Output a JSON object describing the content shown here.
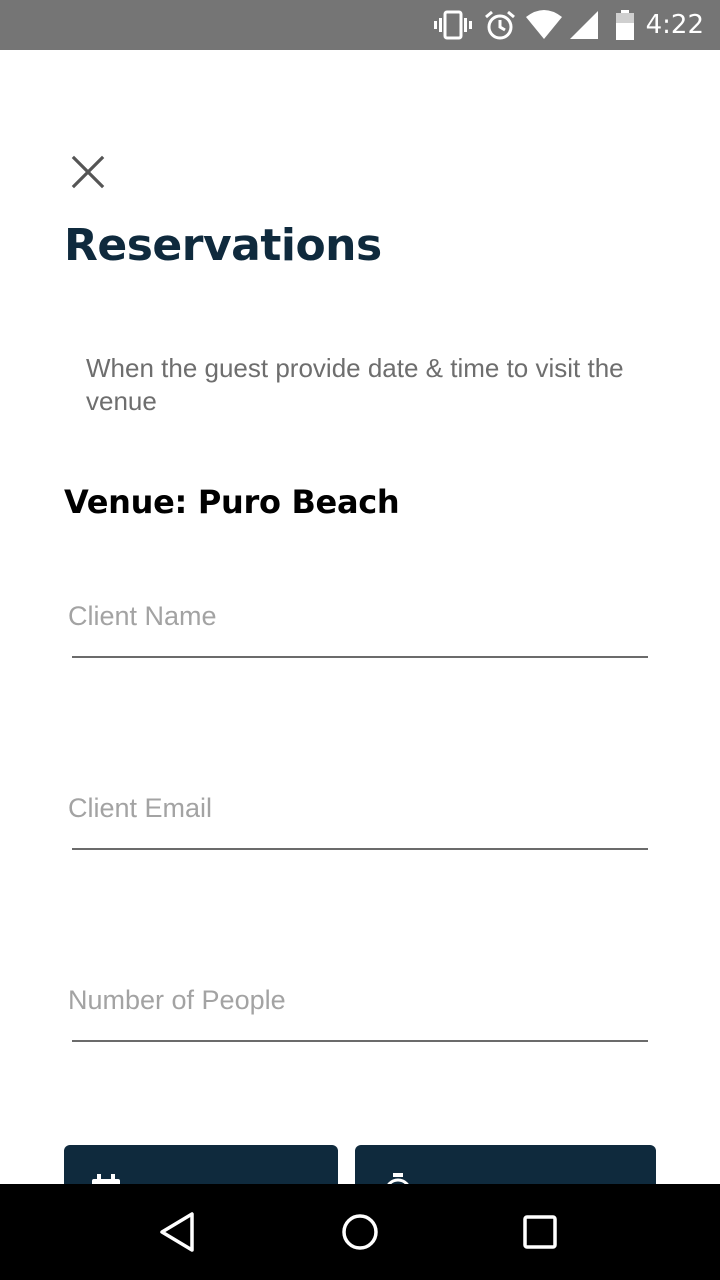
{
  "status_bar": {
    "time": "4:22",
    "icons": [
      "vibrate-icon",
      "alarm-icon",
      "wifi-icon",
      "signal-icon",
      "battery-icon"
    ],
    "background": "#757575"
  },
  "header": {
    "close_icon": "close-icon",
    "title": "Reservations"
  },
  "description": "When the guest provide date & time to visit the venue",
  "venue": {
    "label": "Venue: Puro Beach"
  },
  "form": {
    "client_name": {
      "value": "",
      "placeholder": "Client Name"
    },
    "client_email": {
      "value": "",
      "placeholder": "Client Email"
    },
    "number_of_people": {
      "value": "",
      "placeholder": "Number of People"
    }
  },
  "actions": {
    "date_button_icon": "calendar-icon",
    "time_button_icon": "stopwatch-icon"
  },
  "nav_bar": {
    "back_icon": "back-triangle-icon",
    "home_icon": "home-circle-icon",
    "recents_icon": "recents-square-icon"
  },
  "colors": {
    "primary": "#0f2a3d",
    "placeholder": "#a3a3a3",
    "description": "#6e6e6e"
  }
}
